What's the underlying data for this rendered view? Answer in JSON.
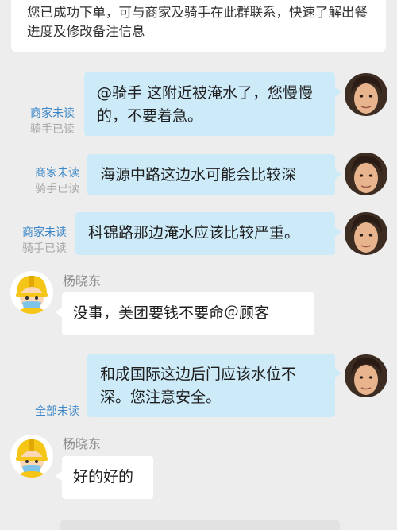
{
  "notice": {
    "text": "您已成功下单，可与商家及骑手在此群联系，快速了解出餐进度及修改备注信息"
  },
  "messages": [
    {
      "side": "out",
      "text": "@骑手 这附近被淹水了，您慢慢的，不要着急。",
      "status_unread": "商家未读",
      "status_read": "骑手已读"
    },
    {
      "side": "out",
      "text": "海源中路这边水可能会比较深",
      "status_unread": "商家未读",
      "status_read": "骑手已读"
    },
    {
      "side": "out",
      "text": "科锦路那边淹水应该比较严重。",
      "status_unread": "商家未读",
      "status_read": "骑手已读"
    },
    {
      "side": "in",
      "sender": "杨晓东",
      "text": "没事，美团要钱不要命＠顾客"
    },
    {
      "side": "out",
      "text": "和成国际这边后门应该水位不深。您注意安全。",
      "status_unread": "全部未读"
    },
    {
      "side": "in",
      "sender": "杨晓东",
      "text": "好的好的"
    }
  ],
  "colors": {
    "background": "#ededed",
    "outgoing_bubble": "#cdeaf9",
    "incoming_bubble": "#ffffff",
    "unread_text": "#3a86c9",
    "read_text": "#a6a6a6"
  },
  "icons": {
    "user_avatar": "user-avatar-photo",
    "rider_avatar": "rider-helmet-mask-avatar"
  }
}
